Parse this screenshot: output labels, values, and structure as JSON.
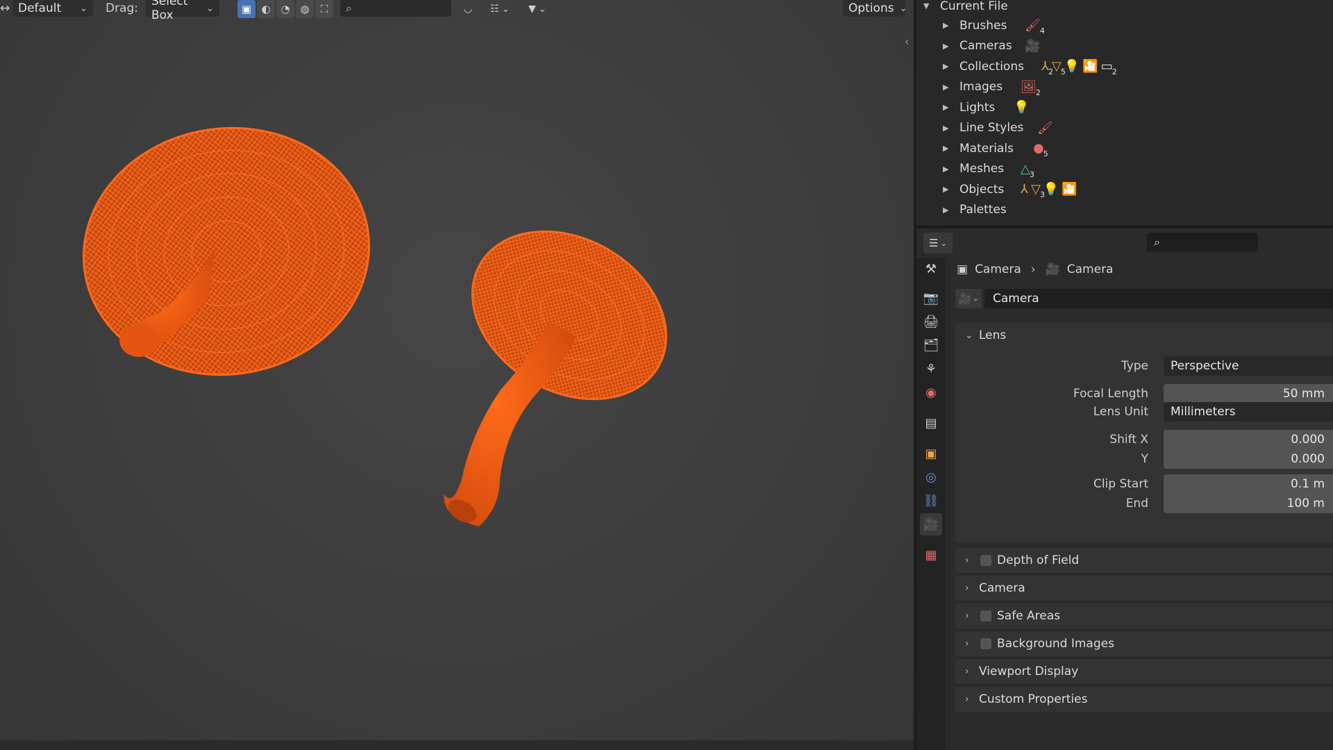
{
  "viewport_header": {
    "workspace_select": "Default",
    "drag_label": "Drag:",
    "drag_select": "Select Box",
    "options_label": "Options"
  },
  "outliner": {
    "root": "Current File",
    "items": [
      {
        "label": "Brushes",
        "icons": [
          {
            "glyph": "🖌",
            "color": "#e06a6a",
            "count": "4"
          }
        ]
      },
      {
        "label": "Cameras",
        "icons": [
          {
            "glyph": "🎥",
            "color": "#4fc39b",
            "count": ""
          }
        ]
      },
      {
        "label": "Collections",
        "icons": [
          {
            "glyph": "⅄",
            "color": "#e9a54a",
            "count": "2"
          },
          {
            "glyph": "▽",
            "color": "#e9a54a",
            "count": "5"
          },
          {
            "glyph": "💡",
            "color": "#e9a54a",
            "count": ""
          },
          {
            "glyph": "🎦",
            "color": "#e9a54a",
            "count": ""
          },
          {
            "glyph": "▭",
            "color": "#e6e6e6",
            "count": "2"
          }
        ]
      },
      {
        "label": "Images",
        "icons": [
          {
            "glyph": "🖼",
            "color": "#e06a6a",
            "count": "2"
          }
        ]
      },
      {
        "label": "Lights",
        "icons": [
          {
            "glyph": "💡",
            "color": "#4fc39b",
            "count": ""
          }
        ]
      },
      {
        "label": "Line Styles",
        "icons": [
          {
            "glyph": "🖌",
            "color": "#e06a6a",
            "count": ""
          }
        ]
      },
      {
        "label": "Materials",
        "icons": [
          {
            "glyph": "●",
            "color": "#e06a6a",
            "count": "5"
          }
        ]
      },
      {
        "label": "Meshes",
        "icons": [
          {
            "glyph": "△",
            "color": "#4fc39b",
            "count": "3"
          }
        ]
      },
      {
        "label": "Objects",
        "icons": [
          {
            "glyph": "⅄",
            "color": "#e9a54a",
            "count": ""
          },
          {
            "glyph": "▽",
            "color": "#e9a54a",
            "count": "3"
          },
          {
            "glyph": "💡",
            "color": "#e9a54a",
            "count": ""
          },
          {
            "glyph": "🎦",
            "color": "#e9a54a",
            "count": ""
          }
        ]
      },
      {
        "label": "Palettes",
        "icons": []
      }
    ]
  },
  "properties": {
    "breadcrumb": [
      "Camera",
      "Camera"
    ],
    "datablock_name": "Camera",
    "lens_panel": {
      "title": "Lens",
      "rows": [
        {
          "label": "Type",
          "value": "Perspective",
          "style": "dark-left"
        },
        {
          "label": "Focal Length",
          "value": "50 mm",
          "style": "right"
        },
        {
          "label": "Lens Unit",
          "value": "Millimeters",
          "style": "dark-left"
        },
        {
          "label": "Shift X",
          "value": "0.000",
          "style": "right"
        },
        {
          "label": "Y",
          "value": "0.000",
          "style": "right"
        },
        {
          "label": "Clip Start",
          "value": "0.1 m",
          "style": "right"
        },
        {
          "label": "End",
          "value": "100 m",
          "style": "right"
        }
      ]
    },
    "collapsed_panels": [
      {
        "label": "Depth of Field",
        "checkbox": true
      },
      {
        "label": "Camera",
        "checkbox": false
      },
      {
        "label": "Safe Areas",
        "checkbox": true
      },
      {
        "label": "Background Images",
        "checkbox": true
      },
      {
        "label": "Viewport Display",
        "checkbox": false
      },
      {
        "label": "Custom Properties",
        "checkbox": false
      }
    ]
  },
  "colors": {
    "accent": "#4772b3",
    "mushroom": "#e0500f",
    "camera_green": "#4fc39b"
  }
}
